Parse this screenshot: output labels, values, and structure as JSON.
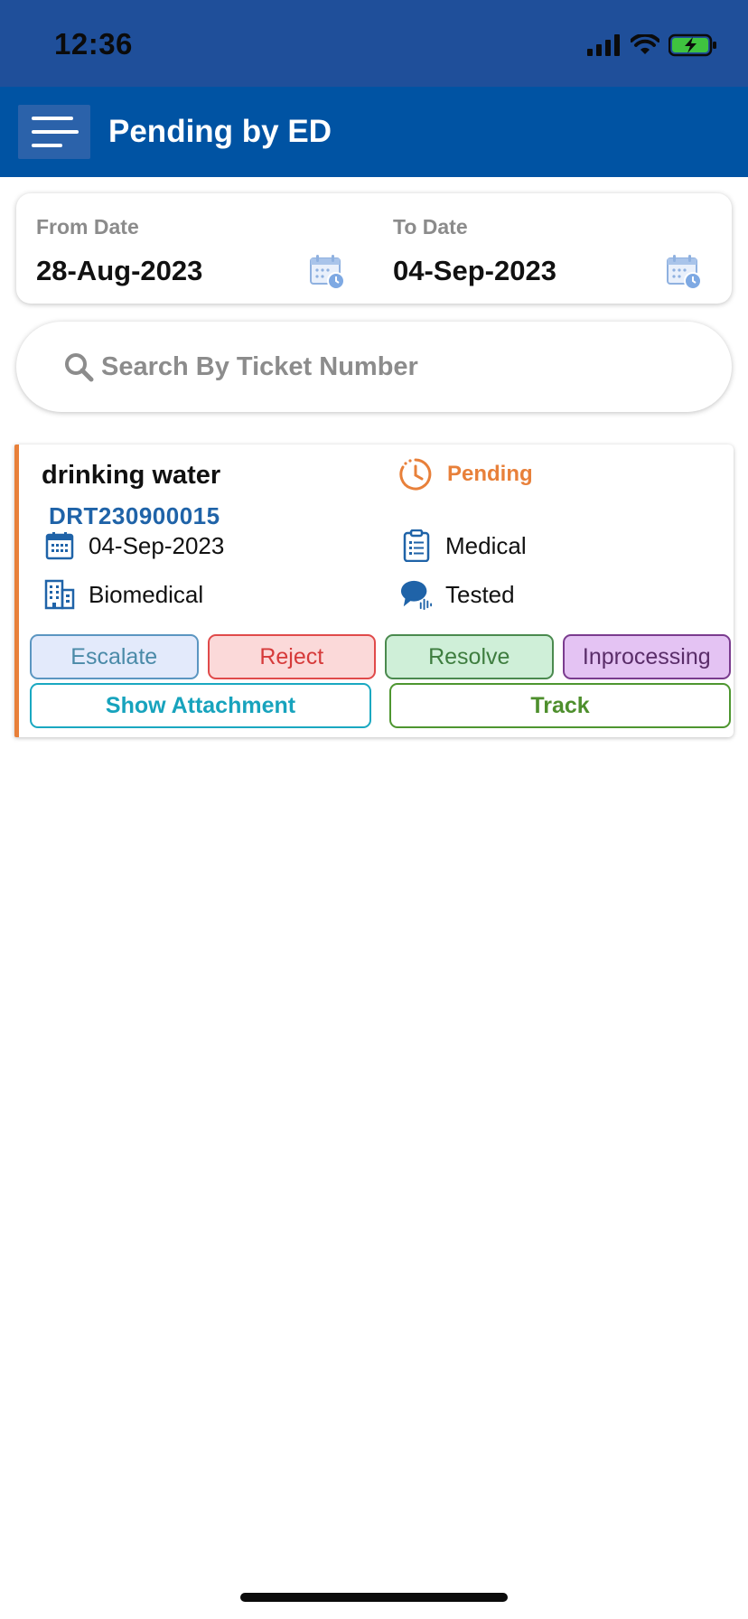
{
  "status_bar": {
    "time": "12:36"
  },
  "header": {
    "title": "Pending by ED",
    "menu_icon": "hamburger-icon"
  },
  "date_filter": {
    "from_label": "From Date",
    "from_value": "28-Aug-2023",
    "to_label": "To Date",
    "to_value": "04-Sep-2023",
    "calendar_icon": "calendar-clock-icon"
  },
  "search": {
    "placeholder": "Search By Ticket Number"
  },
  "ticket": {
    "title": "drinking water",
    "number": "DRT230900015",
    "status": "Pending",
    "date": "04-Sep-2023",
    "category": "Medical",
    "department": "Biomedical",
    "remark": "Tested",
    "actions": {
      "escalate": "Escalate",
      "reject": "Reject",
      "resolve": "Resolve",
      "inprocessing": "Inprocessing"
    },
    "links": {
      "attachment": "Show Attachment",
      "track": "Track"
    }
  },
  "colors": {
    "header_bg": "#0053a3",
    "status_bar_bg": "#1f4f9a",
    "accent_orange": "#e8803a",
    "ticket_number": "#1f63a8"
  }
}
